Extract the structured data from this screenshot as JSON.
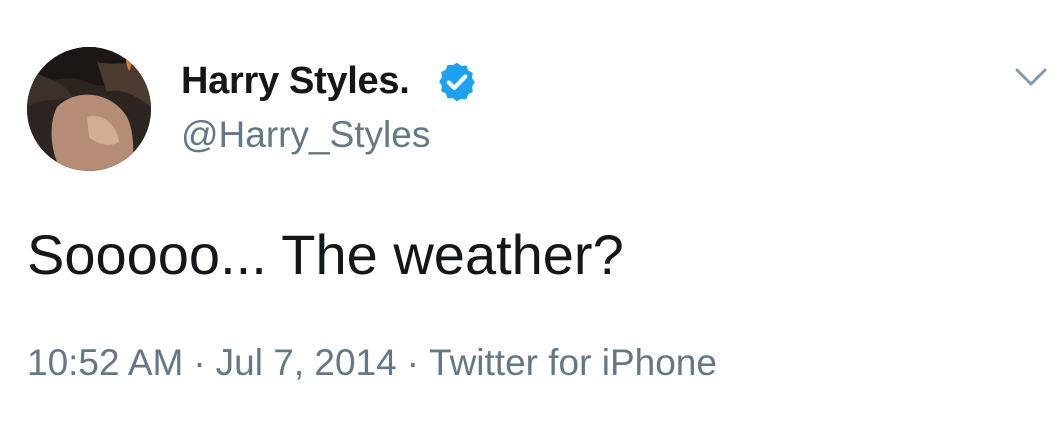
{
  "tweet": {
    "display_name": "Harry Styles.",
    "handle": "@Harry_Styles",
    "text": "Sooooo... The weather?",
    "time": "10:52 AM",
    "date": "Jul 7, 2014",
    "source": "Twitter for iPhone",
    "separator": "·"
  },
  "icons": {
    "verified": "verified-badge-icon",
    "menu": "chevron-down-icon",
    "avatar": "profile-photo"
  },
  "colors": {
    "text": "#14171a",
    "secondary": "#657786",
    "verified_blue": "#1da1f2"
  }
}
